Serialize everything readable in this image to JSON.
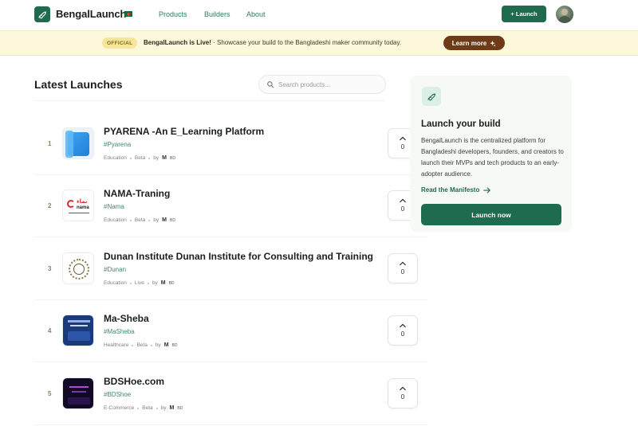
{
  "header": {
    "brand": "BengalLaunch",
    "nav": [
      "Products",
      "Builders",
      "About"
    ],
    "launch_button": "+ Launch"
  },
  "banner": {
    "badge": "OFFICIAL",
    "headline": "BengalLaunch is Live!",
    "separator": "·",
    "message": "Showcase your build to the Bangladeshi maker community today.",
    "cta": "Learn more"
  },
  "main": {
    "title": "Latest Launches",
    "search_placeholder": "Search products..."
  },
  "products": [
    {
      "rank": "1",
      "name": "PYARENA -An E_Learning Platform",
      "tag": "#Pyarena",
      "category": "Education",
      "stage": "Beta",
      "by": "by",
      "maker": "M",
      "country": "BD",
      "votes": "0"
    },
    {
      "rank": "2",
      "name": "NAMA-Traning",
      "tag": "#Nama",
      "category": "Education",
      "stage": "Beta",
      "by": "by",
      "maker": "M",
      "country": "BD",
      "votes": "0"
    },
    {
      "rank": "3",
      "name": "Dunan Institute Dunan Institute for Consulting and Training",
      "tag": "#Dunan",
      "category": "Education",
      "stage": "Live",
      "by": "by",
      "maker": "M",
      "country": "BD",
      "votes": "0"
    },
    {
      "rank": "4",
      "name": "Ma-Sheba",
      "tag": "#MaSheba",
      "category": "Healthcare",
      "stage": "Beta",
      "by": "by",
      "maker": "M",
      "country": "BD",
      "votes": "0"
    },
    {
      "rank": "5",
      "name": "BDSHoe.com",
      "tag": "#BDShoe",
      "category": "E-Commerce",
      "stage": "Beta",
      "by": "by",
      "maker": "M",
      "country": "BD",
      "votes": "0"
    }
  ],
  "sidebar": {
    "title": "Launch your build",
    "text": "BengalLaunch is the centralized platform for Bangladeshi developers, founders, and creators to launch their MVPs and tech products to an early-adopter audience.",
    "link": "Read the Manifesto",
    "button": "Launch now"
  },
  "colors": {
    "brand_green": "#1f6b4d",
    "banner_bg": "#fdf8dc",
    "learn_more_bg": "#6e3b16",
    "tag_green": "#3f8a66"
  },
  "icons": {
    "logo": "rocket-icon",
    "flag": "bangladesh-flag-icon",
    "search": "search-icon",
    "upvote": "chevron-up-icon",
    "learn_more": "sparkle-icon",
    "card": "rocket-icon",
    "link": "arrow-right-icon"
  }
}
